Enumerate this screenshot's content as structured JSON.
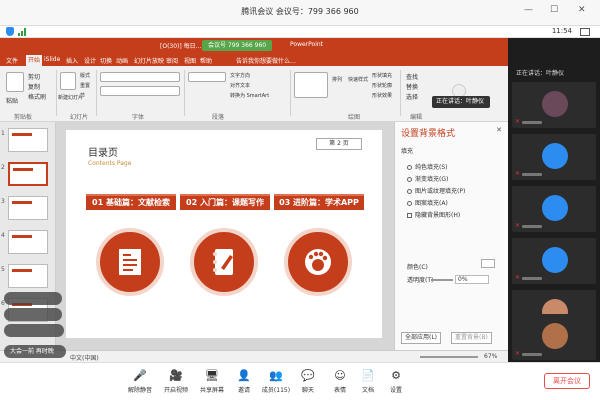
{
  "window": {
    "title": "腾讯会议 会议号：799 366 960",
    "time": "11:54"
  },
  "ppt": {
    "file_label": "[O(30)] 每日…",
    "meeting_indicator": "会议号 799 366 960",
    "app_name": "PowerPoint",
    "search_hint": "告诉我你想要做什么…",
    "tabs": [
      "文件",
      "开始",
      "iSlide",
      "插入",
      "设计",
      "切换",
      "动画",
      "幻灯片放映",
      "审阅",
      "视图",
      "帮助"
    ],
    "active_tab": "开始",
    "ribbon": {
      "paste": "粘贴",
      "new_slide": "新建幻灯片",
      "reuse": "重用幻灯片",
      "layout": "版式",
      "reset": "重置",
      "section": "节",
      "cut": "剪切",
      "copy": "复制",
      "format_painter": "格式刷",
      "text_direction": "文字方向",
      "align_text": "对齐文本",
      "smartart": "转换为 SmartArt",
      "arrange": "排列",
      "quick_styles": "快速样式",
      "shape_fill": "形状填充",
      "shape_outline": "形状轮廓",
      "shape_effects": "形状效果",
      "find": "查找",
      "replace": "替换",
      "select": "选择",
      "groups": [
        "剪贴板",
        "幻灯片",
        "字体",
        "段落",
        "绘图",
        "编辑"
      ]
    },
    "slide_numbers": [
      "1",
      "2",
      "3",
      "4",
      "5",
      "6"
    ],
    "slide": {
      "title": "目录页",
      "subtitle": "Contents Page",
      "page_tag": "第 2 页",
      "sections": [
        "01 基础篇：文献检索",
        "02 入门篇：课题写作",
        "03 进阶篇：学术APP"
      ]
    },
    "format_pane": {
      "title": "设置背景格式",
      "section": "填充",
      "options": [
        "纯色填充(S)",
        "渐变填充(G)",
        "图片或纹理填充(P)",
        "图案填充(A)",
        "隐藏背景图形(H)"
      ],
      "color_label": "颜色(C)",
      "transparency_label": "透明度(T)",
      "transparency_value": "0%",
      "apply_all": "全部应用(L)",
      "reset_bg": "重置背景(B)"
    },
    "status": {
      "language": "中文(中国)",
      "zoom": "67%"
    }
  },
  "overlay": {
    "speaker_popup": "正在讲话：叶静仪",
    "chat_messages": [
      "",
      "",
      "",
      "大会一前 再时晚"
    ]
  },
  "participants": {
    "speaking_label": "正在讲话：叶静仪",
    "avatar_colors": [
      "#6a4a5a",
      "#2d8cf0",
      "#2d8cf0",
      "#2d8cf0",
      "#c98a6a",
      "#b0704a"
    ]
  },
  "toolbar": {
    "items": [
      "解除静音",
      "开启视频",
      "共享屏幕",
      "邀请",
      "成员(115)",
      "聊天",
      "表情",
      "文档",
      "设置"
    ],
    "leave": "离开会议"
  }
}
